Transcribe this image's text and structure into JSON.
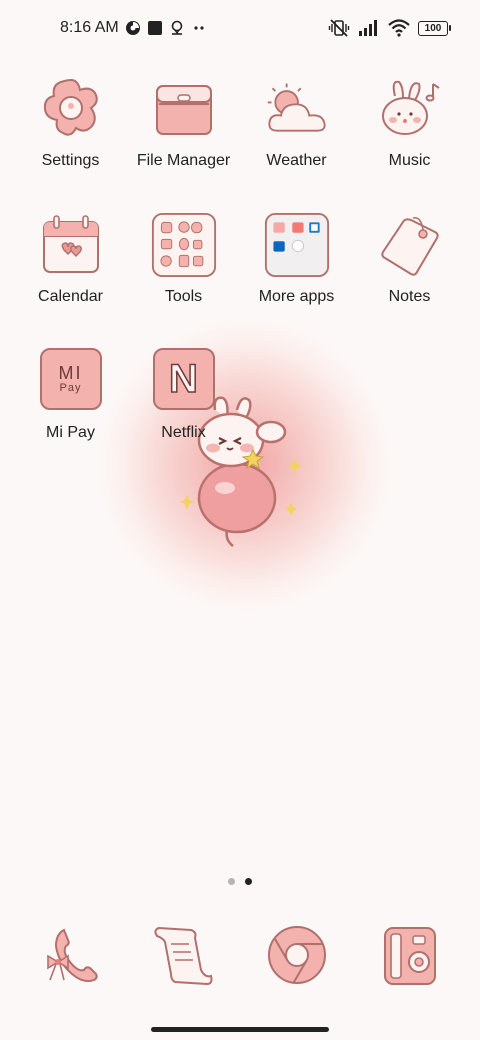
{
  "status_bar": {
    "time": "8:16 AM",
    "left_icons": [
      "data-saver-icon",
      "square-notification-icon",
      "location-icon",
      "more-notifications-icon"
    ],
    "right_icons": [
      "vibrate-mute-icon",
      "signal-icon",
      "wifi-icon"
    ],
    "battery_level": "100"
  },
  "home": {
    "apps": [
      {
        "label": "Settings",
        "icon": "settings-flower-icon"
      },
      {
        "label": "File Manager",
        "icon": "folder-icon"
      },
      {
        "label": "Weather",
        "icon": "weather-sun-cloud-icon"
      },
      {
        "label": "Music",
        "icon": "bunny-music-icon"
      },
      {
        "label": "Calendar",
        "icon": "calendar-hearts-icon"
      },
      {
        "label": "Tools",
        "icon": "tools-folder-icon"
      },
      {
        "label": "More apps",
        "icon": "more-apps-folder-icon"
      },
      {
        "label": "Notes",
        "icon": "tag-notes-icon"
      },
      {
        "label": "Mi Pay",
        "icon": "mi-pay-icon",
        "icon_text": "MI",
        "icon_subtext": "Pay"
      },
      {
        "label": "Netflix",
        "icon": "netflix-icon",
        "icon_text": "N"
      }
    ],
    "page_indicator": {
      "pages": 2,
      "current": 2
    }
  },
  "dock": {
    "apps": [
      {
        "icon": "phone-bow-icon"
      },
      {
        "icon": "messages-scroll-icon"
      },
      {
        "icon": "chrome-icon"
      },
      {
        "icon": "camera-icon"
      }
    ]
  },
  "colors": {
    "background": "#fcf8f7",
    "icon_pink": "#f4b6b2",
    "icon_outline": "#b0706c",
    "text": "#222222",
    "dot_active": "#222222",
    "dot_inactive": "#b5b5b5"
  }
}
